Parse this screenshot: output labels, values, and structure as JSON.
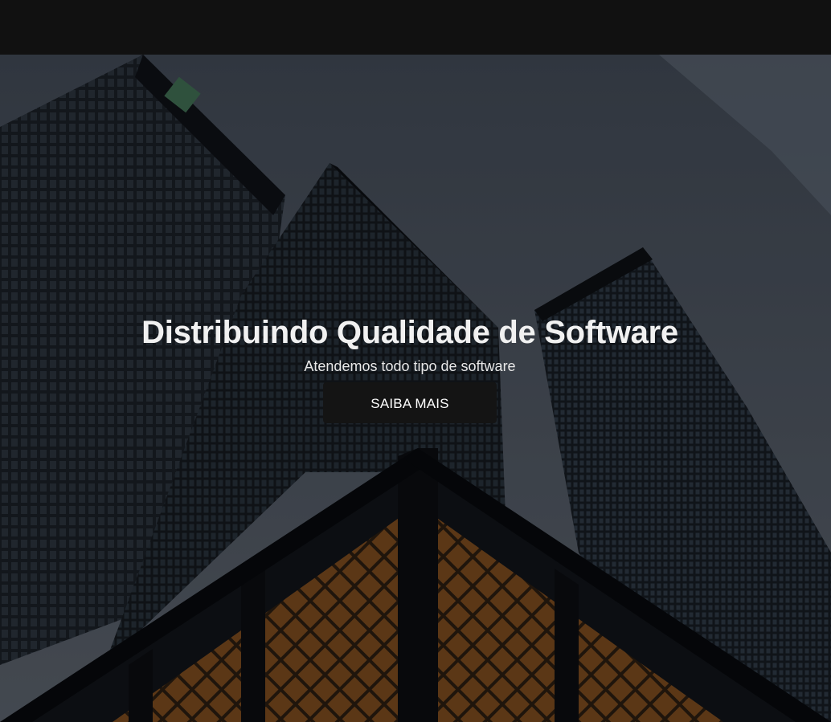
{
  "hero": {
    "title": "Distribuindo Qualidade de Software",
    "subtitle": "Atendemos todo tipo de software",
    "button_label": "SAIBA MAIS",
    "background_image": "skyscrapers-city-photo"
  },
  "colors": {
    "topbar": "#111111",
    "button_bg": "#141414",
    "title_text": "#f1f1f1"
  }
}
